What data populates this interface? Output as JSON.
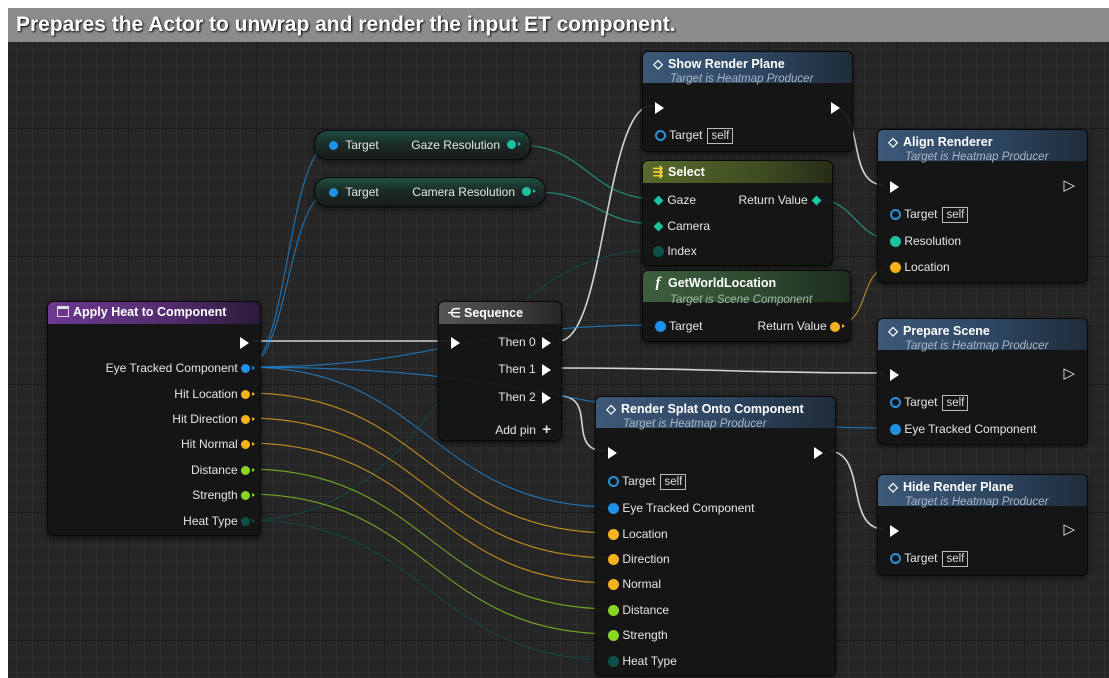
{
  "comment": "Prepares the Actor to unwrap and render the input ET component.",
  "colors": {
    "object_pin": "#1e90e8",
    "struct_pin": "#f5b21f",
    "float_pin": "#8bd624",
    "byte_pin": "#0f4f4a",
    "intpoint_pin": "#1ec1a0",
    "function_header": "#3d5878",
    "pure_header": "#3d5e3e",
    "event_header": "#6c3a90"
  },
  "apply_heat": {
    "title": "Apply Heat to Component",
    "icon": "event-icon",
    "outputs": [
      "Eye Tracked Component",
      "Hit Location",
      "Hit Direction",
      "Hit Normal",
      "Distance",
      "Strength",
      "Heat Type"
    ]
  },
  "getters": [
    {
      "target": "Target",
      "property": "Gaze Resolution"
    },
    {
      "target": "Target",
      "property": "Camera Resolution"
    }
  ],
  "sequence": {
    "title": "Sequence",
    "outputs": [
      "Then 0",
      "Then 1",
      "Then 2"
    ],
    "add_pin": "Add pin"
  },
  "show_render_plane": {
    "title": "Show Render Plane",
    "subtitle": "Target is Heatmap Producer",
    "target": "Target",
    "self": "self"
  },
  "select": {
    "title": "Select",
    "pins": [
      "Gaze",
      "Camera",
      "Index"
    ],
    "return": "Return Value"
  },
  "get_world_location": {
    "title": "GetWorldLocation",
    "subtitle": "Target is Scene Component",
    "target": "Target",
    "return": "Return Value",
    "icon": "f"
  },
  "align_renderer": {
    "title": "Align Renderer",
    "subtitle": "Target is Heatmap Producer",
    "target": "Target",
    "self": "self",
    "pins": [
      "Resolution",
      "Location"
    ]
  },
  "prepare_scene": {
    "title": "Prepare Scene",
    "subtitle": "Target is Heatmap Producer",
    "target": "Target",
    "self": "self",
    "pins": [
      "Eye Tracked Component"
    ]
  },
  "render_splat": {
    "title": "Render Splat Onto Component",
    "subtitle": "Target is Heatmap Producer",
    "target": "Target",
    "self": "self",
    "pins": [
      "Eye Tracked Component",
      "Location",
      "Direction",
      "Normal",
      "Distance",
      "Strength",
      "Heat Type"
    ]
  },
  "hide_render_plane": {
    "title": "Hide Render Plane",
    "subtitle": "Target is Heatmap Producer",
    "target": "Target",
    "self": "self"
  }
}
